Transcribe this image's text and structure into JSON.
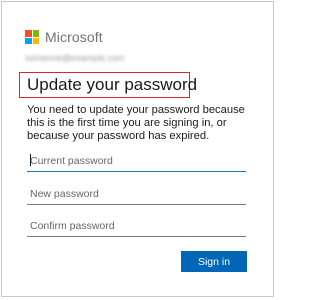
{
  "brand": {
    "name": "Microsoft",
    "logo_colors": [
      "#f25022",
      "#7fba00",
      "#00a4ef",
      "#ffb900"
    ],
    "logo_icon": "microsoft-logo-icon"
  },
  "account": {
    "email": "someone@example.com"
  },
  "page": {
    "title": "Update your password",
    "description": "You need to update your password because this is the first time you are signing in, or because your password has expired."
  },
  "form": {
    "current_password": {
      "placeholder": "Current password",
      "value": ""
    },
    "new_password": {
      "placeholder": "New password",
      "value": ""
    },
    "confirm_password": {
      "placeholder": "Confirm password",
      "value": ""
    },
    "submit_label": "Sign in"
  },
  "colors": {
    "accent": "#0067b8",
    "highlight_border": "#d42a2a"
  }
}
